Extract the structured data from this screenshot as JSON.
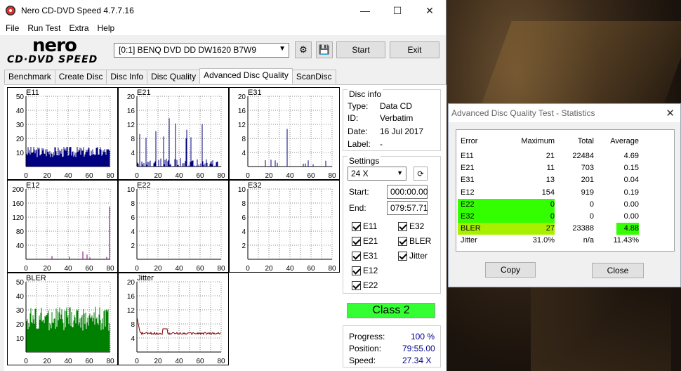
{
  "window": {
    "title": "Nero CD-DVD Speed 4.7.7.16",
    "min": "—",
    "max": "☐",
    "close": "✕"
  },
  "menu": [
    "File",
    "Run Test",
    "Extra",
    "Help"
  ],
  "logo": {
    "line1": "nero",
    "line2": "CD·DVD SPEED"
  },
  "toolbar": {
    "drive": "[0:1]   BENQ DVD DD DW1620 B7W9",
    "start_label": "Start",
    "exit_label": "Exit"
  },
  "tabs": [
    "Benchmark",
    "Create Disc",
    "Disc Info",
    "Disc Quality",
    "Advanced Disc Quality",
    "ScanDisc"
  ],
  "active_tab": "Advanced Disc Quality",
  "disc_info": {
    "heading": "Disc info",
    "type_label": "Type:",
    "type": "Data CD",
    "id_label": "ID:",
    "id": "Verbatim",
    "date_label": "Date:",
    "date": "16 Jul 2017",
    "label_label": "Label:",
    "label": "-"
  },
  "settings": {
    "heading": "Settings",
    "speed": "24 X",
    "start_label": "Start:",
    "start": "000:00.00",
    "end_label": "End:",
    "end": "079:57.71",
    "checks": [
      "E11",
      "E32",
      "E21",
      "BLER",
      "E31",
      "Jitter",
      "E12",
      "E22"
    ]
  },
  "class_label": "Class 2",
  "progress": {
    "progress_label": "Progress:",
    "progress": "100 %",
    "position_label": "Position:",
    "position": "79:55.00",
    "speed_label": "Speed:",
    "speed": "27.34 X"
  },
  "charts": [
    {
      "name": "E11",
      "yticks": [
        "50",
        "40",
        "30",
        "20",
        "10"
      ],
      "xticks": [
        "0",
        "20",
        "40",
        "60",
        "80"
      ],
      "color": "#000080"
    },
    {
      "name": "E21",
      "yticks": [
        "20",
        "16",
        "12",
        "8",
        "4"
      ],
      "xticks": [
        "0",
        "20",
        "40",
        "60",
        "80"
      ],
      "color": "#000080"
    },
    {
      "name": "E31",
      "yticks": [
        "20",
        "16",
        "12",
        "8",
        "4"
      ],
      "xticks": [
        "0",
        "20",
        "40",
        "60",
        "80"
      ],
      "color": "#000080"
    },
    {
      "name": "E12",
      "yticks": [
        "200",
        "160",
        "120",
        "80",
        "40"
      ],
      "xticks": [
        "0",
        "20",
        "40",
        "60",
        "80"
      ],
      "color": "#800080"
    },
    {
      "name": "E22",
      "yticks": [
        "10",
        "8",
        "6",
        "4",
        "2"
      ],
      "xticks": [
        "0",
        "20",
        "40",
        "60",
        "80"
      ],
      "color": "#000080"
    },
    {
      "name": "E32",
      "yticks": [
        "10",
        "8",
        "6",
        "4",
        "2"
      ],
      "xticks": [
        "0",
        "20",
        "40",
        "60",
        "80"
      ],
      "color": "#000080"
    },
    {
      "name": "BLER",
      "yticks": [
        "50",
        "40",
        "30",
        "20",
        "10"
      ],
      "xticks": [
        "0",
        "20",
        "40",
        "60",
        "80"
      ],
      "color": "#008000"
    },
    {
      "name": "Jitter",
      "yticks": [
        "20",
        "16",
        "12",
        "8",
        "4"
      ],
      "xticks": [
        "0",
        "20",
        "40",
        "60",
        "80"
      ],
      "color": "#800000"
    }
  ],
  "stats": {
    "title": "Advanced Disc Quality Test - Statistics",
    "headers": [
      "Error",
      "Maximum",
      "Total",
      "Average"
    ],
    "rows": [
      [
        "E11",
        "21",
        "22484",
        "4.69"
      ],
      [
        "E21",
        "11",
        "703",
        "0.15"
      ],
      [
        "E31",
        "13",
        "201",
        "0.04"
      ],
      [
        "E12",
        "154",
        "919",
        "0.19"
      ],
      [
        "E22",
        "0",
        "0",
        "0.00"
      ],
      [
        "E32",
        "0",
        "0",
        "0.00"
      ],
      [
        "BLER",
        "27",
        "23388",
        "4.88"
      ],
      [
        "Jitter",
        "31.0%",
        "n/a",
        "11.43%"
      ]
    ],
    "copy_label": "Copy",
    "close_label": "Close"
  }
}
